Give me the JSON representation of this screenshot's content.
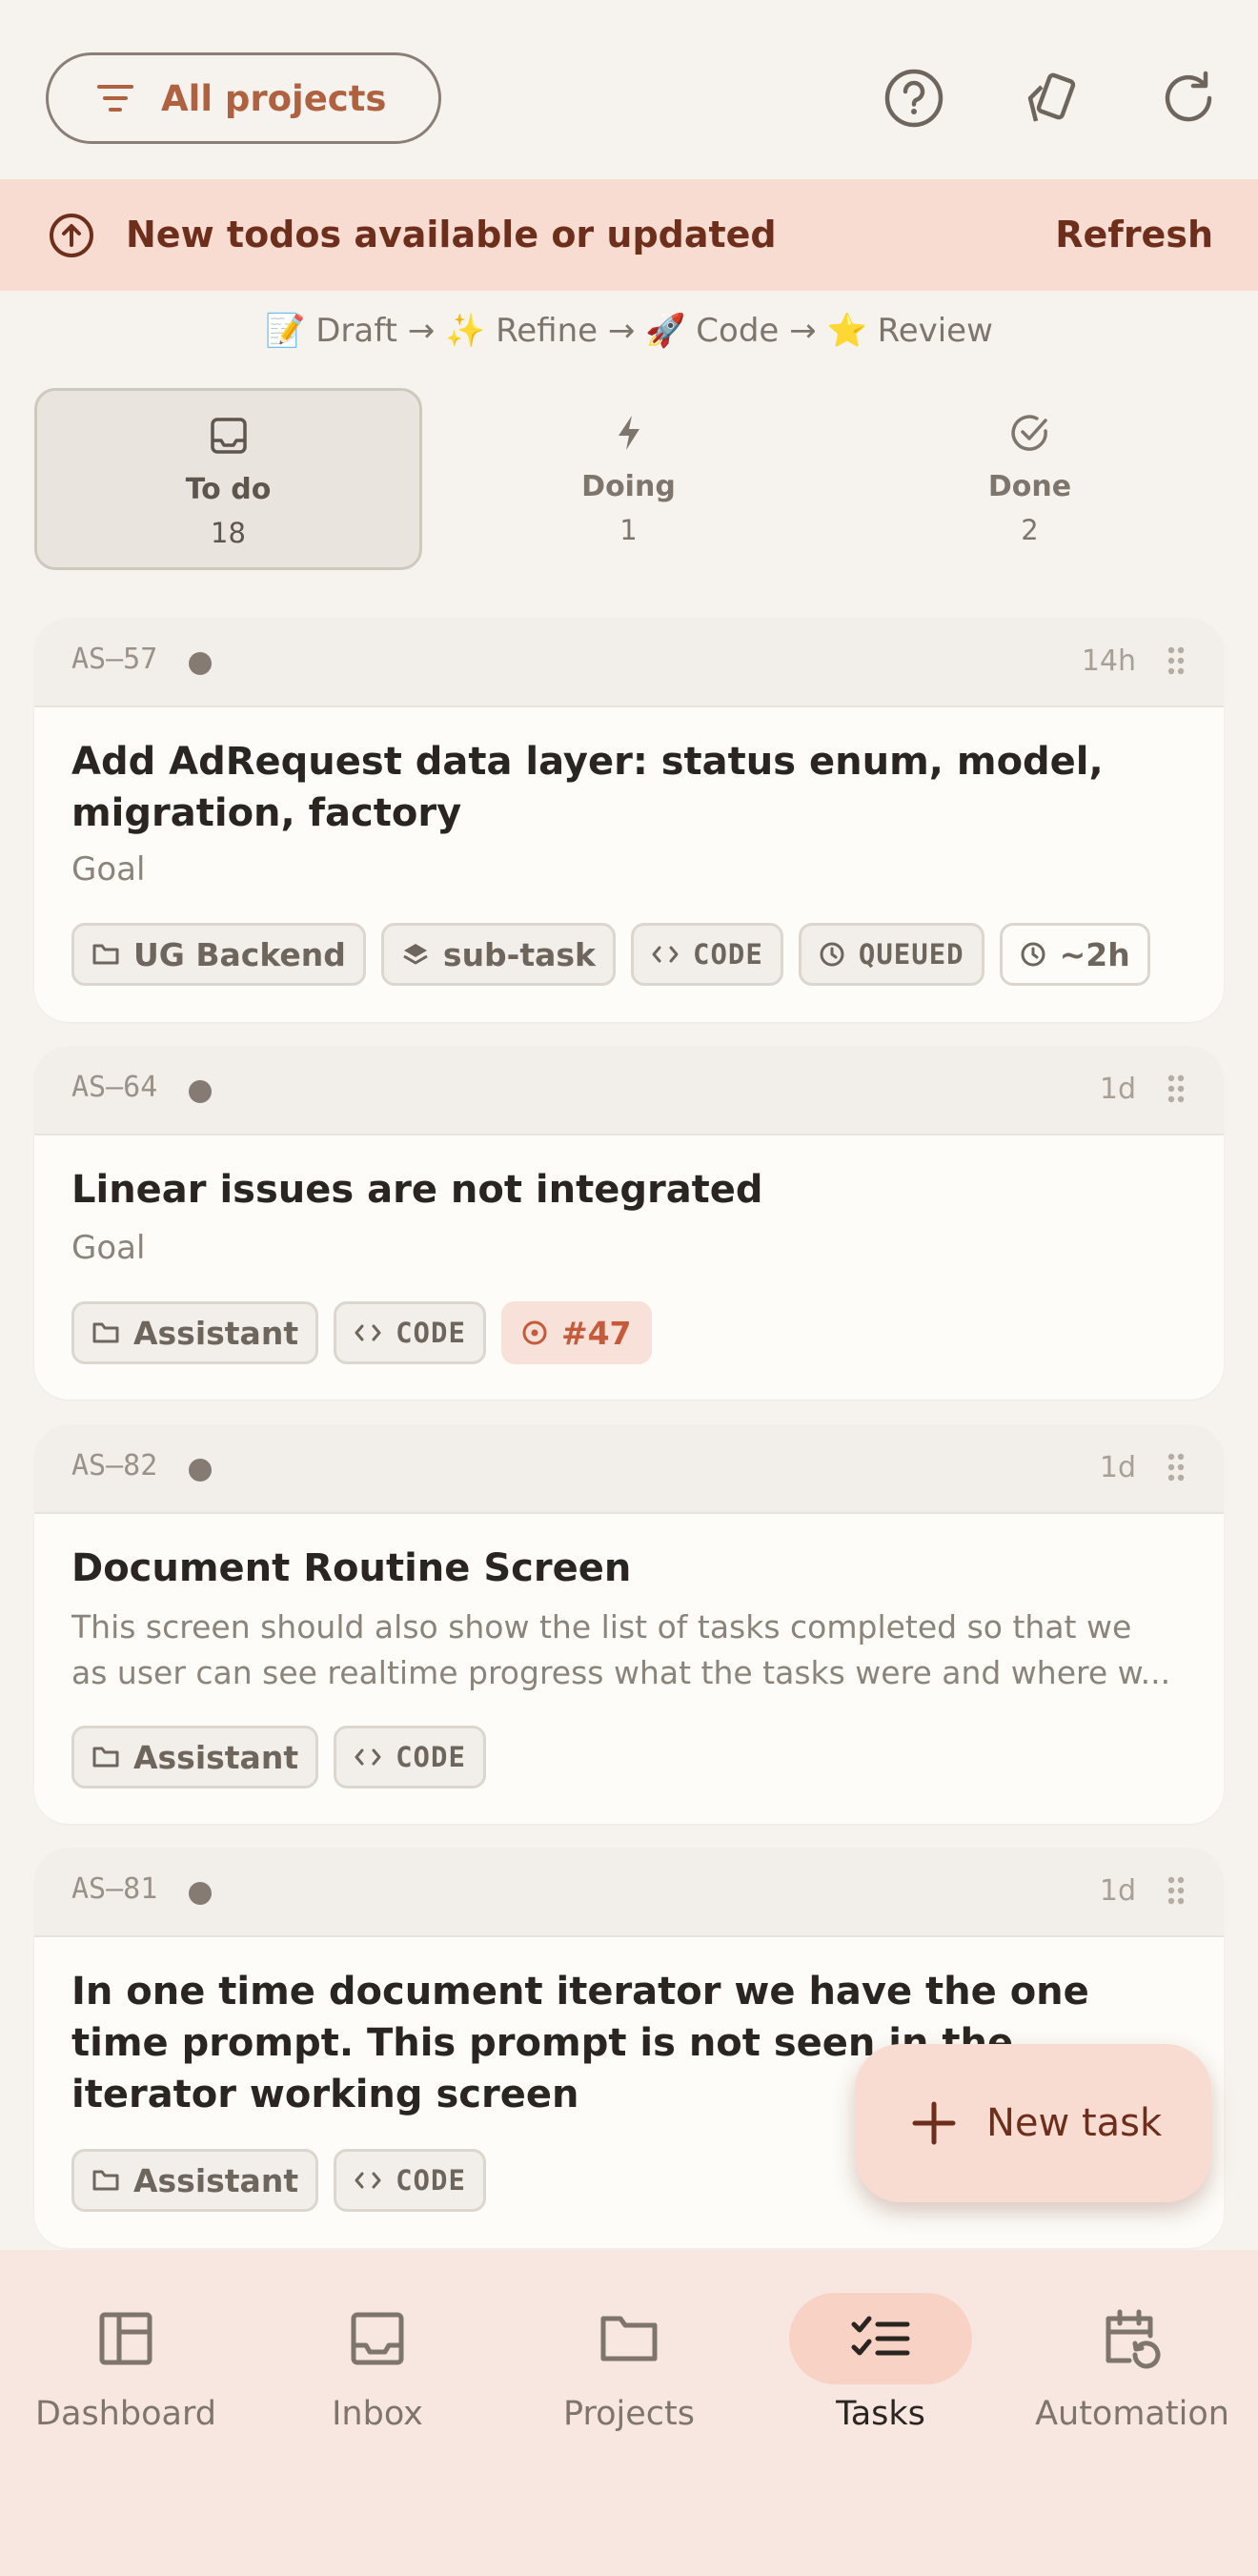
{
  "header": {
    "projects_button": "All projects",
    "icons": [
      "help-icon",
      "tags-icon",
      "refresh-icon"
    ]
  },
  "banner": {
    "message": "New todos available or updated",
    "action": "Refresh",
    "icon": "arrow-up-circle-icon"
  },
  "workflow": {
    "steps_text": "📝 Draft → ✨ Refine → 🚀 Code → ⭐ Review"
  },
  "tabs": [
    {
      "label": "To do",
      "count": "18",
      "icon": "inbox-icon",
      "active": true
    },
    {
      "label": "Doing",
      "count": "1",
      "icon": "bolt-icon",
      "active": false
    },
    {
      "label": "Done",
      "count": "2",
      "icon": "check-circle-icon",
      "active": false
    }
  ],
  "tasks": [
    {
      "id": "AS–57",
      "age": "14h",
      "title": "Add AdRequest data layer: status enum, model, migration, factory",
      "subtitle": "Goal",
      "tags": {
        "project": "UG Backend",
        "type": "sub-task",
        "stage": "CODE",
        "status": "QUEUED",
        "estimate": "~2h"
      }
    },
    {
      "id": "AS–64",
      "age": "1d",
      "title": "Linear issues are not integrated",
      "subtitle": "Goal",
      "tags": {
        "project": "Assistant",
        "stage": "CODE",
        "issue": "#47"
      }
    },
    {
      "id": "AS–82",
      "age": "1d",
      "title": "Document Routine Screen",
      "description_line1": "This screen should also show the list of tasks completed so that we",
      "description_line2": "as user can see realtime progress what the tasks were and where w...",
      "tags": {
        "project": "Assistant",
        "stage": "CODE"
      }
    },
    {
      "id": "AS–81",
      "age": "1d",
      "title": "In one time document iterator we have the one time prompt. This prompt is not seen in the iterator working screen",
      "tags": {
        "project": "Assistant",
        "stage": "CODE"
      }
    }
  ],
  "fab": {
    "label": "New task"
  },
  "bottom_nav": [
    {
      "label": "Dashboard",
      "icon": "dashboard-icon",
      "active": false
    },
    {
      "label": "Inbox",
      "icon": "inbox-icon",
      "active": false
    },
    {
      "label": "Projects",
      "icon": "folder-icon",
      "active": false
    },
    {
      "label": "Tasks",
      "icon": "tasks-icon",
      "active": true
    },
    {
      "label": "Automation",
      "icon": "calendar-clock-icon",
      "active": false
    }
  ],
  "colors": {
    "accent": "#B0613F",
    "banner_bg": "#F8DCD2",
    "nav_bg": "#F8E7E1",
    "card_bg": "#FDFCF8"
  }
}
